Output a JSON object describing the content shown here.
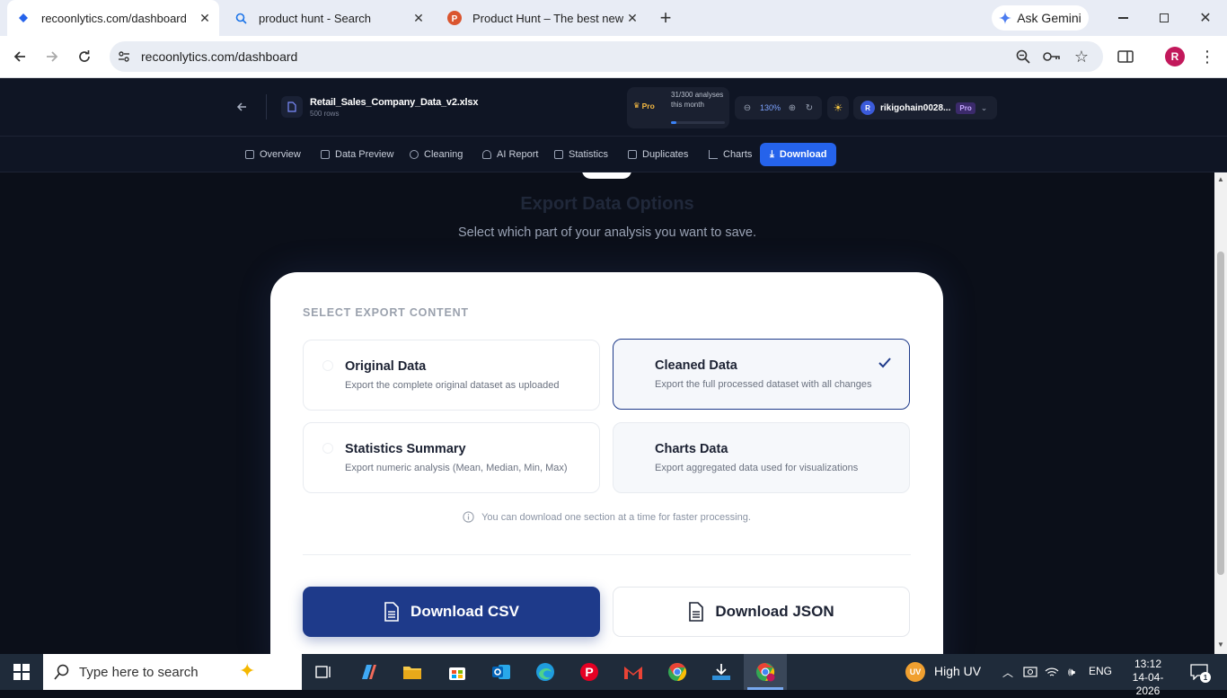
{
  "browser": {
    "tabs": [
      {
        "title": "recoonlytics.com/dashboard",
        "active": true
      },
      {
        "title": "product hunt - Search",
        "active": false
      },
      {
        "title": "Product Hunt – The best new p",
        "active": false
      }
    ],
    "ask_gemini": "Ask Gemini",
    "url": "recoonlytics.com/dashboard",
    "profile_initial": "R"
  },
  "app": {
    "file_name": "Retail_Sales_Company_Data_v2.xlsx",
    "file_rows": "500 rows",
    "plan_badge": "Pro",
    "usage_text": "31/300 analyses this month",
    "usage_fraction": 0.103,
    "zoom": "130%",
    "user_initial": "R",
    "user_name": "rikigohain0028...",
    "user_badge": "Pro",
    "nav": [
      "Overview",
      "Data Preview",
      "Cleaning",
      "AI Report",
      "Statistics",
      "Duplicates",
      "Charts",
      "Download"
    ]
  },
  "export": {
    "heading": "Export Data Options",
    "subheading": "Select which part of your analysis you want to save.",
    "section_label": "SELECT EXPORT CONTENT",
    "options": [
      {
        "title": "Original Data",
        "desc": "Export the complete original dataset as uploaded",
        "selected": false
      },
      {
        "title": "Cleaned Data",
        "desc": "Export the full processed dataset with all changes",
        "selected": true
      },
      {
        "title": "Statistics Summary",
        "desc": "Export numeric analysis (Mean, Median, Min, Max)",
        "selected": false
      },
      {
        "title": "Charts Data",
        "desc": "Export aggregated data used for visualizations",
        "selected": false
      }
    ],
    "info": "You can download one section at a time for faster processing.",
    "btn_csv": "Download CSV",
    "btn_json": "Download JSON"
  },
  "taskbar": {
    "search_placeholder": "Type here to search",
    "uv_badge": "UV",
    "weather": "High UV",
    "lang": "ENG",
    "time": "13:12",
    "date": "14-04-2026",
    "notif_count": "1"
  },
  "colors": {
    "accent": "#2563eb",
    "dark_bg": "#0b0f19",
    "header_bg": "#0f1524",
    "csv_button": "#1e3a8a",
    "pro_badge": "#7c3aed"
  }
}
